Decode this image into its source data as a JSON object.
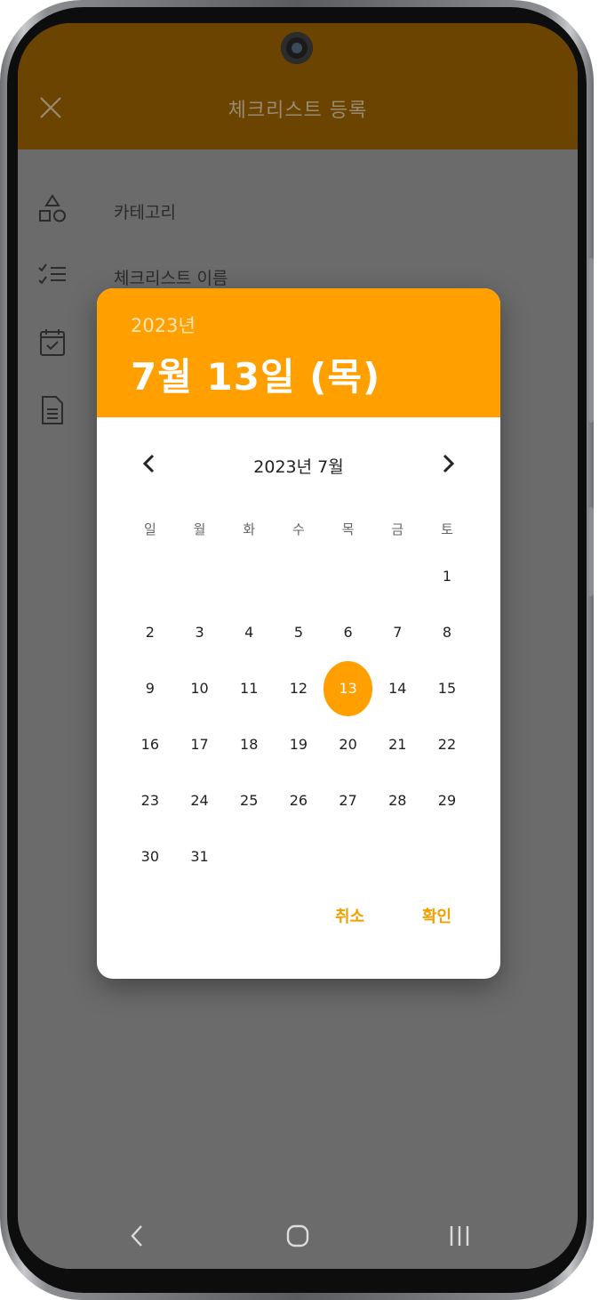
{
  "app": {
    "title": "체크리스트 등록",
    "close_icon": "close-icon"
  },
  "form": {
    "rows": [
      {
        "label": "카테고리",
        "icon": "shapes-icon"
      },
      {
        "label": "체크리스트 이름",
        "icon": "checklist-icon"
      },
      {
        "label": "",
        "icon": "calendar-check-icon"
      },
      {
        "label": "",
        "icon": "document-icon"
      }
    ]
  },
  "datepicker": {
    "header_year": "2023년",
    "header_date": "7월 13일 (목)",
    "month_label": "2023년 7월",
    "weekdays": [
      "일",
      "월",
      "화",
      "수",
      "목",
      "금",
      "토"
    ],
    "weeks": [
      [
        "",
        "",
        "",
        "",
        "",
        "",
        "1"
      ],
      [
        "2",
        "3",
        "4",
        "5",
        "6",
        "7",
        "8"
      ],
      [
        "9",
        "10",
        "11",
        "12",
        "13",
        "14",
        "15"
      ],
      [
        "16",
        "17",
        "18",
        "19",
        "20",
        "21",
        "22"
      ],
      [
        "23",
        "24",
        "25",
        "26",
        "27",
        "28",
        "29"
      ],
      [
        "30",
        "31",
        "",
        "",
        "",
        "",
        ""
      ]
    ],
    "selected_day": "13",
    "cancel_label": "취소",
    "ok_label": "확인"
  },
  "colors": {
    "accent": "#ff9f00",
    "header_bg": "#6a4400",
    "overlay_bg": "#6b6b6b",
    "action_text": "#f0a000"
  }
}
